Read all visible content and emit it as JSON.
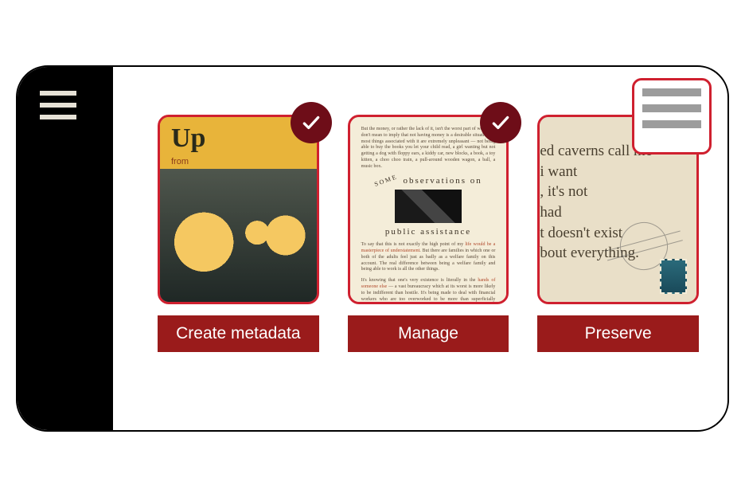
{
  "sidebar": {
    "menu_icon": "hamburger-icon"
  },
  "cards": [
    {
      "label": "Create metadata",
      "completed": true,
      "thumb": {
        "kind": "magazine",
        "title": "Up",
        "subtitle": "from"
      }
    },
    {
      "label": "Manage",
      "completed": true,
      "thumb": {
        "kind": "document",
        "heading_left": "SOME",
        "heading_mid": "observations on",
        "heading_bottom": "public assistance"
      }
    },
    {
      "label": "Preserve",
      "completed": false,
      "has_form_overlay": true,
      "thumb": {
        "kind": "postcard",
        "lines": [
          "ed caverns call me",
          "i want",
          ", it's not",
          "had",
          "t doesn't exist",
          "bout everything."
        ]
      }
    }
  ],
  "colors": {
    "accent": "#cf202f",
    "button": "#9a1b1b",
    "badge": "#6e0d18"
  }
}
